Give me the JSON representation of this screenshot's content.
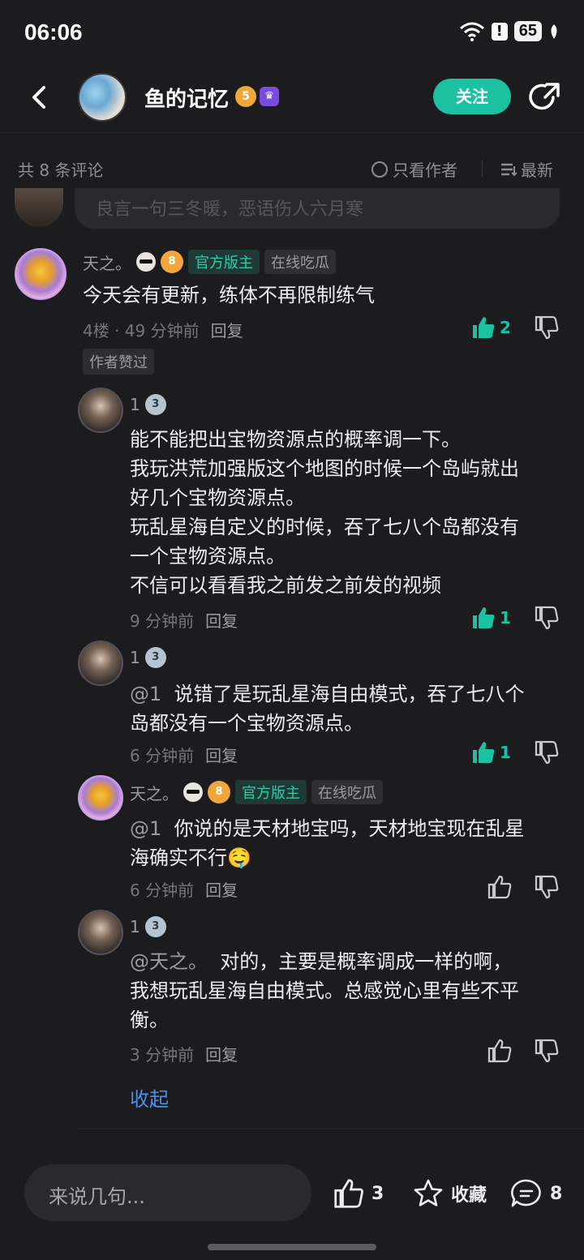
{
  "status": {
    "time": "06:06",
    "battery": "65"
  },
  "header": {
    "title": "鱼的记忆",
    "level_badge": "5",
    "follow_label": "关注"
  },
  "filter": {
    "count_label": "共 8 条评论",
    "author_only_label": "只看作者",
    "sort_label": "最新"
  },
  "previous": {
    "partial_text": "良言一句三冬暖，恶语伤人六月寒"
  },
  "main_comment": {
    "user": "天之。",
    "level": "8",
    "tag_official": "官方版主",
    "tag_title": "在线吃瓜",
    "text": "今天会有更新，练体不再限制练气",
    "floor_time": "4楼 · 49 分钟前",
    "reply_label": "回复",
    "likes": "2",
    "author_liked": "作者赞过"
  },
  "replies": [
    {
      "user": "1",
      "level": "3",
      "lines": [
        "能不能把出宝物资源点的概率调一下。",
        "我玩洪荒加强版这个地图的时候一个岛屿就出",
        "好几个宝物资源点。",
        "玩乱星海自定义的时候，吞了七八个岛都没有",
        "一个宝物资源点。",
        "不信可以看看我之前发之前发的视频"
      ],
      "time": "9 分钟前",
      "reply_label": "回复",
      "likes": "1"
    },
    {
      "user": "1",
      "level": "3",
      "mention": "@1",
      "lines": [
        "说错了是玩乱星海自由模式，吞了七八个",
        "岛都没有一个宝物资源点。"
      ],
      "time": "6 分钟前",
      "reply_label": "回复",
      "likes": "1"
    },
    {
      "user": "天之。",
      "level": "8",
      "tag_official": "官方版主",
      "tag_title": "在线吃瓜",
      "mention": "@1",
      "lines": [
        "你说的是天材地宝吗，天材地宝现在乱星",
        "海确实不行🤤"
      ],
      "time": "6 分钟前",
      "reply_label": "回复"
    },
    {
      "user": "1",
      "level": "3",
      "mention": "@天之。",
      "lines": [
        "对的，主要是概率调成一样的啊，",
        "我想玩乱星海自由模式。总感觉心里有些不平",
        "衡。"
      ],
      "time": "3 分钟前",
      "reply_label": "回复"
    }
  ],
  "collapse_label": "收起",
  "bottom": {
    "input_placeholder": "来说几句...",
    "like_count": "3",
    "favorite_label": "收藏",
    "comment_count": "8"
  },
  "colors": {
    "accent": "#1cc1a2",
    "link": "#4e8ee8",
    "background": "#1c1c1f"
  }
}
